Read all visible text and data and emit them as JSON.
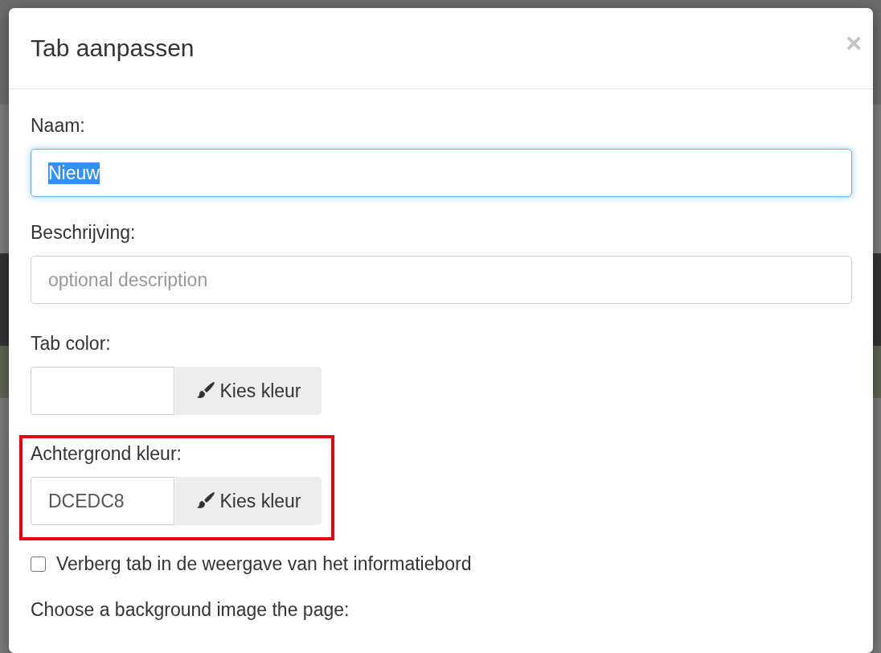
{
  "dialog": {
    "title": "Tab aanpassen",
    "close": "×",
    "fields": [
      {
        "kind": "text",
        "label": "Naam:",
        "value": "Nieuw",
        "focused": true,
        "text_selected": true
      },
      {
        "kind": "text",
        "label": "Beschrijving:",
        "placeholder": "optional description",
        "focused": false,
        "text_selected": false
      },
      {
        "kind": "color",
        "label": "Tab color:",
        "button": "Kies kleur",
        "highlighted": false
      },
      {
        "kind": "color",
        "label": "Achtergrond kleur:",
        "value": "DCEDC8",
        "button": "Kies kleur",
        "highlighted": true
      },
      {
        "kind": "checkbox",
        "label": "Verberg tab in de weergave van het informatiebord",
        "checked": false
      },
      {
        "kind": "heading",
        "label": "Choose a background image the page:"
      }
    ]
  }
}
